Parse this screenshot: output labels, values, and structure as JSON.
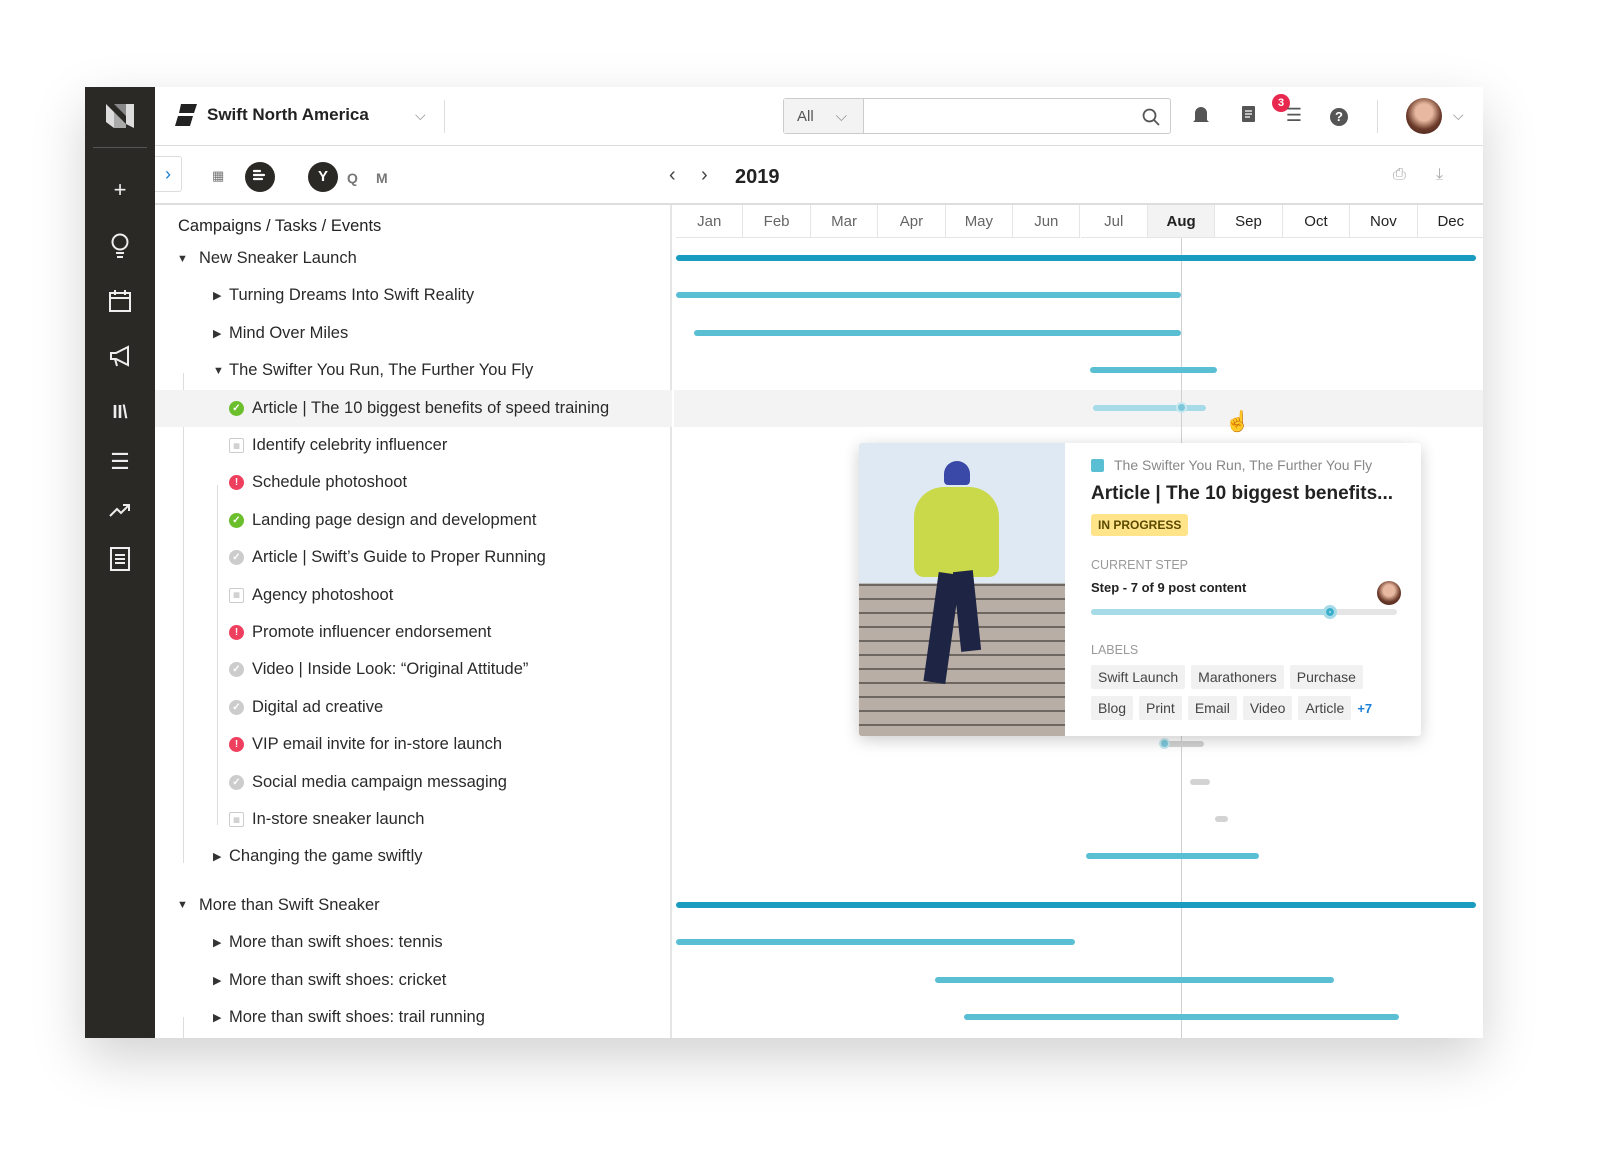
{
  "header": {
    "org": "Swift North America",
    "search_scope": "All",
    "search_placeholder": "",
    "notifications": "3"
  },
  "sidebar": {
    "items": [
      "add",
      "ideas",
      "calendar",
      "campaigns",
      "library",
      "list",
      "analytics",
      "reports"
    ]
  },
  "toolbar": {
    "year": "2019",
    "zoom": [
      "Y",
      "Q",
      "M"
    ],
    "active_zoom": "Y"
  },
  "panel": {
    "title": "Campaigns / Tasks / Events"
  },
  "months": [
    "Jan",
    "Feb",
    "Mar",
    "Apr",
    "May",
    "Jun",
    "Jul",
    "Aug",
    "Sep",
    "Oct",
    "Nov",
    "Dec"
  ],
  "current_month": "Aug",
  "today": "2019-08-17",
  "colors": {
    "campaign": "#1a9cc0",
    "program": "#5bbfd4",
    "task_light": "#a6dbe7",
    "task_grey": "#d3d3d3",
    "done": "#6cbf2c",
    "alert": "#ef3f5e"
  },
  "rows": [
    {
      "label": "New Sneaker Launch",
      "level": 0,
      "toggle": "open",
      "bar": {
        "start": "2019-01-01",
        "end": "2019-12-28",
        "kind": "campaign"
      }
    },
    {
      "label": "Turning Dreams Into Swift Reality",
      "level": 1,
      "toggle": "closed",
      "bar": {
        "start": "2019-01-01",
        "end": "2019-08-17",
        "kind": "program"
      }
    },
    {
      "label": "Mind Over Miles",
      "level": 1,
      "toggle": "closed",
      "bar": {
        "start": "2019-01-09",
        "end": "2019-08-17",
        "kind": "program"
      }
    },
    {
      "label": "The Swifter You Run, The Further You Fly",
      "level": 1,
      "toggle": "open",
      "bar": {
        "start": "2019-07-07",
        "end": "2019-09-02",
        "kind": "program"
      }
    },
    {
      "label": "Article | The 10 biggest benefits of speed training",
      "level": 2,
      "status": "done",
      "highlight": true,
      "bar": {
        "start": "2019-07-08",
        "end": "2019-08-28",
        "kind": "task_light",
        "progress": 0.78
      }
    },
    {
      "label": "Identify celebrity influencer",
      "level": 2,
      "status": "cal"
    },
    {
      "label": "Schedule photoshoot",
      "level": 2,
      "status": "alert"
    },
    {
      "label": "Landing page design and development",
      "level": 2,
      "status": "done"
    },
    {
      "label": "Article | Swift’s Guide to Proper Running",
      "level": 2,
      "status": "grey"
    },
    {
      "label": "Agency photoshoot",
      "level": 2,
      "status": "cal"
    },
    {
      "label": "Promote influencer endorsement",
      "level": 2,
      "status": "alert"
    },
    {
      "label": "Video | Inside Look: “Original Attitude”",
      "level": 2,
      "status": "grey"
    },
    {
      "label": "Digital ad creative",
      "level": 2,
      "status": "grey"
    },
    {
      "label": "VIP email invite for in-store launch",
      "level": 2,
      "status": "alert",
      "bar": {
        "start": "2019-08-09",
        "end": "2019-08-27",
        "kind": "task_grey",
        "progress": 0
      }
    },
    {
      "label": "Social media campaign messaging",
      "level": 2,
      "status": "grey",
      "bar": {
        "start": "2019-08-21",
        "end": "2019-08-30",
        "kind": "task_grey"
      }
    },
    {
      "label": "In-store sneaker launch",
      "level": 2,
      "status": "cal",
      "bar": {
        "start": "2019-09-01",
        "end": "2019-09-07",
        "kind": "task_grey"
      }
    },
    {
      "label": "Changing the game swiftly",
      "level": 1,
      "toggle": "closed",
      "bar": {
        "start": "2019-07-05",
        "end": "2019-09-21",
        "kind": "program"
      }
    },
    {
      "label": "More than Swift Sneaker",
      "level": 0,
      "toggle": "open",
      "bar": {
        "start": "2019-01-01",
        "end": "2019-12-28",
        "kind": "campaign"
      }
    },
    {
      "label": "More than swift shoes: tennis",
      "level": 1,
      "toggle": "closed",
      "bar": {
        "start": "2019-01-01",
        "end": "2019-06-30",
        "kind": "program"
      }
    },
    {
      "label": "More than swift shoes: cricket",
      "level": 1,
      "toggle": "closed",
      "bar": {
        "start": "2019-04-28",
        "end": "2019-10-25",
        "kind": "program"
      }
    },
    {
      "label": "More than swift shoes: trail running",
      "level": 1,
      "toggle": "closed",
      "bar": {
        "start": "2019-05-11",
        "end": "2019-11-23",
        "kind": "program"
      }
    }
  ],
  "popup": {
    "parent": "The Swifter You Run, The Further You Fly",
    "title": "Article | The 10 biggest benefits...",
    "status": "IN PROGRESS",
    "step_label": "CURRENT STEP",
    "step": "Step - 7 of 9 post content",
    "step_progress": 0.78,
    "labels_label": "LABELS",
    "labels": [
      "Swift Launch",
      "Marathoners",
      "Purchase",
      "Blog",
      "Print",
      "Email",
      "Video",
      "Article"
    ],
    "more": "+7"
  }
}
